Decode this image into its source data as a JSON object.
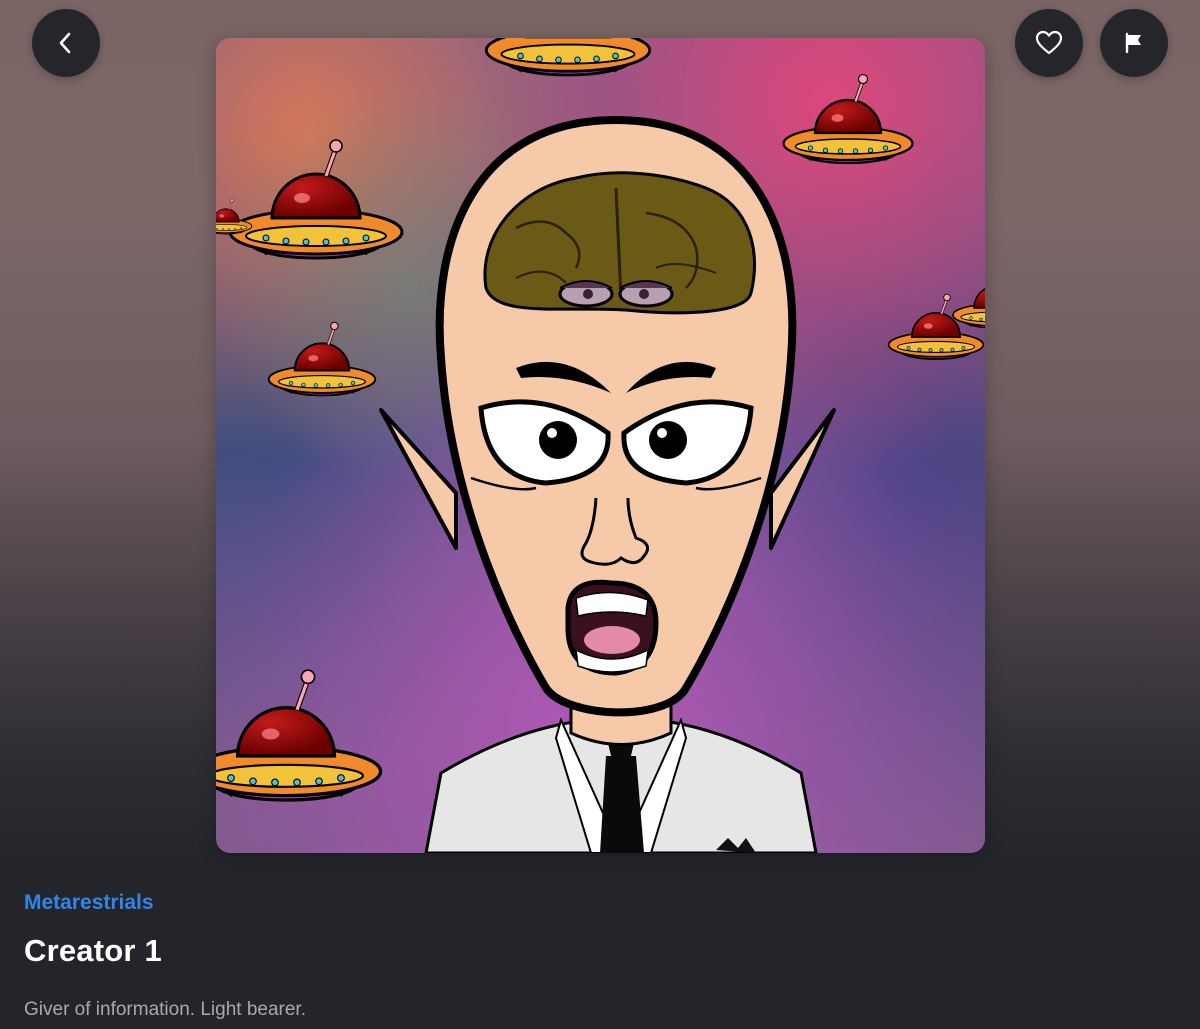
{
  "header": {
    "back_icon": "chevron-left-icon",
    "favorite_icon": "heart-outline-icon",
    "report_icon": "flag-icon"
  },
  "artwork": {
    "subject": "cartoon bald alien with exposed brain, pointed ears, shocked face, white suit and black tie, surrounded by flying saucers on a nebula background"
  },
  "item": {
    "collection": "Metarestrials",
    "title": "Creator 1",
    "description": "Giver of information. Light bearer."
  },
  "colors": {
    "accent": "#2f86e6",
    "panel": "#23252b",
    "button": "#25262b",
    "title": "#ffffff",
    "description": "#a7a9ad"
  }
}
